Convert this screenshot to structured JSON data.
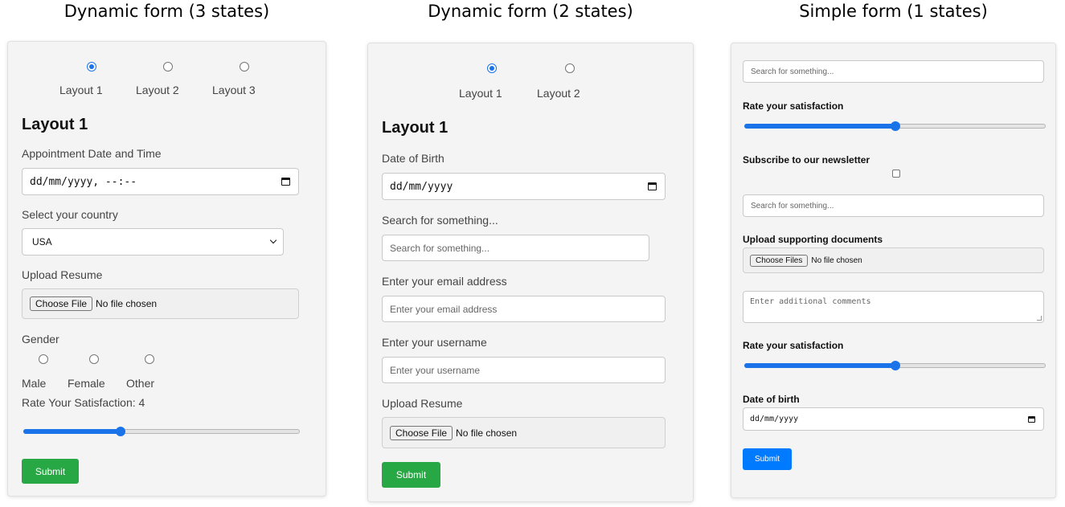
{
  "titles": [
    "Dynamic form (3 states)",
    "Dynamic form (2 states)",
    "Simple form (1 states)"
  ],
  "form1": {
    "layouts": [
      "Layout 1",
      "Layout 2",
      "Layout 3"
    ],
    "selected_layout": 0,
    "heading": "Layout 1",
    "appointment_label": "Appointment Date and Time",
    "appointment_value": "dd/mm/yyyy, --:--",
    "country_label": "Select your country",
    "country_value": "USA",
    "resume_label": "Upload Resume",
    "file_button": "Choose File",
    "file_status": "No file chosen",
    "gender_label": "Gender",
    "genders": [
      "Male",
      "Female",
      "Other"
    ],
    "satisfaction_label": "Rate Your Satisfaction: 4",
    "satisfaction_fraction": 0.35,
    "submit": "Submit"
  },
  "form2": {
    "layouts": [
      "Layout 1",
      "Layout 2"
    ],
    "selected_layout": 0,
    "heading": "Layout 1",
    "dob_label": "Date of Birth",
    "dob_value": "dd/mm/yyyy",
    "search_label": "Search for something...",
    "search_placeholder": "Search for something...",
    "email_label": "Enter your email address",
    "email_placeholder": "Enter your email address",
    "username_label": "Enter your username",
    "username_placeholder": "Enter your username",
    "resume_label": "Upload Resume",
    "file_button": "Choose File",
    "file_status": "No file chosen",
    "submit": "Submit"
  },
  "form3": {
    "search_placeholder_1": "Search for something...",
    "satisfaction_label_1": "Rate your satisfaction",
    "satisfaction_fraction_1": 0.5,
    "newsletter_label": "Subscribe to our newsletter",
    "search_placeholder_2": "Search for something...",
    "docs_label": "Upload supporting documents",
    "file_button": "Choose Files",
    "file_status": "No file chosen",
    "comments_placeholder": "Enter additional comments",
    "satisfaction_label_2": "Rate your satisfaction",
    "satisfaction_fraction_2": 0.5,
    "dob_label": "Date of birth",
    "dob_value": "dd/mm/yyyy",
    "submit": "Submit"
  },
  "colors": {
    "accent": "#1a73e8",
    "green": "#28a745",
    "blue": "#007bff",
    "card": "#f4f4f4"
  }
}
